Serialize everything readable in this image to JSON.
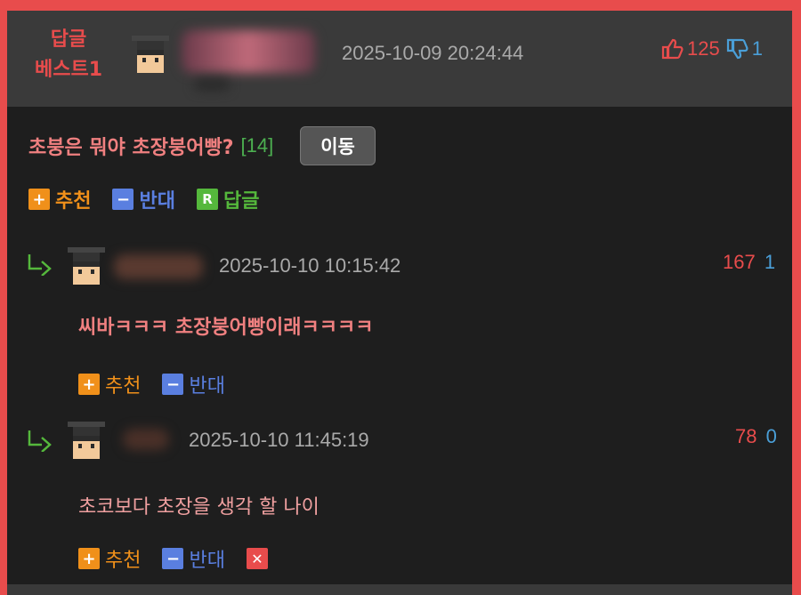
{
  "header": {
    "badge_line1": "답글",
    "badge_line2": "베스트1",
    "date": "2025-10-09 20:24:44",
    "up_count": "125",
    "down_count": "1"
  },
  "post": {
    "title": "초붕은 뭐야 초장붕어빵?",
    "count": "[14]",
    "move_label": "이동"
  },
  "actions": {
    "recommend": "추천",
    "oppose": "반대",
    "reply": "답글"
  },
  "replies": [
    {
      "date": "2025-10-10 10:15:42",
      "up": "167",
      "down": "1",
      "text": "씨바ㅋㅋㅋ 초장붕어빵이래ㅋㅋㅋㅋ"
    },
    {
      "date": "2025-10-10 11:45:19",
      "up": "78",
      "down": "0",
      "text": "초코보다 초장을 생각 할 나이"
    }
  ],
  "icons": {
    "plus": "+",
    "minus": "−",
    "reply_box": "R",
    "delete": "✕"
  },
  "colors": {
    "accent_red": "#e84c4c",
    "up_red": "#e84c4c",
    "down_blue": "#4a9fd8",
    "recommend_orange": "#f0901a",
    "oppose_blue": "#5a7fe0",
    "reply_green": "#55b83c"
  }
}
